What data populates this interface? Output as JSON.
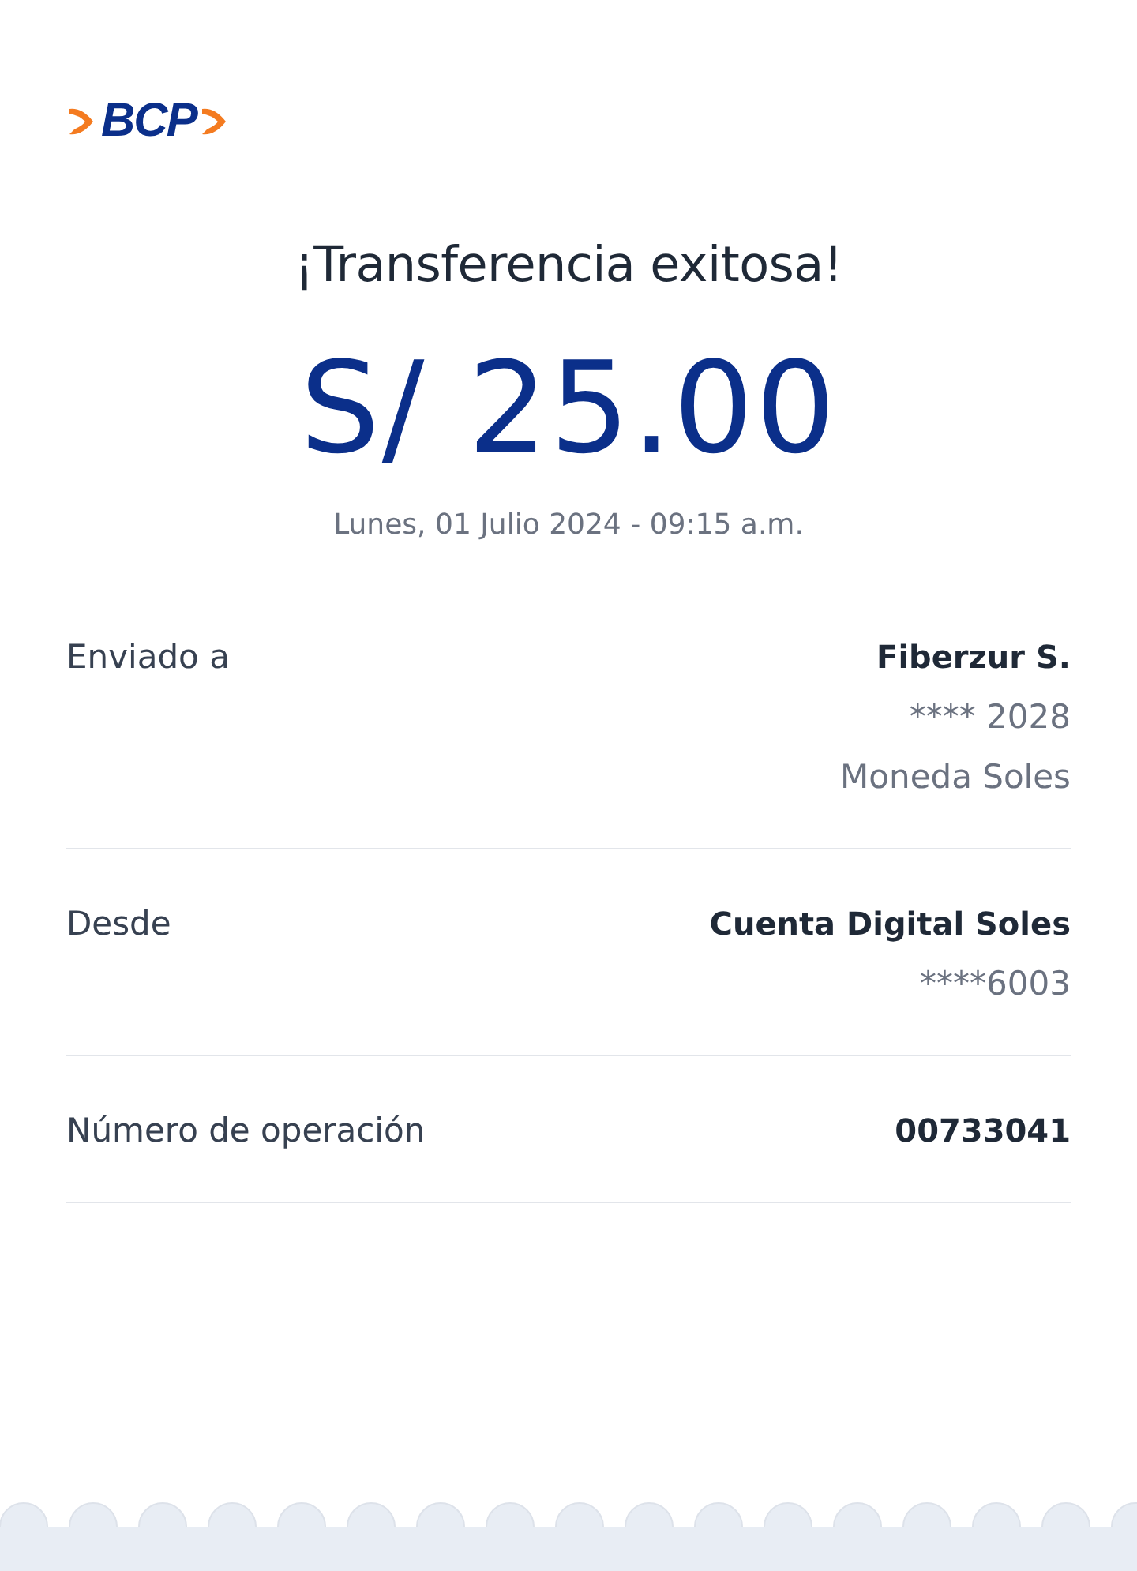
{
  "logo": {
    "text": "BCP"
  },
  "title": "¡Transferencia exitosa!",
  "amount": "S/ 25.00",
  "datetime": "Lunes, 01 Julio 2024 - 09:15 a.m.",
  "details": [
    {
      "label": "Enviado a",
      "values": [
        {
          "text": "Fiberzur S.",
          "kind": "strong"
        },
        {
          "text": "**** 2028",
          "kind": "muted"
        },
        {
          "text": "Moneda Soles",
          "kind": "muted"
        }
      ]
    },
    {
      "label": "Desde",
      "values": [
        {
          "text": "Cuenta Digital Soles",
          "kind": "strong"
        },
        {
          "text": "****6003",
          "kind": "muted"
        }
      ]
    },
    {
      "label": "Número de operación",
      "values": [
        {
          "text": "00733041",
          "kind": "strong"
        }
      ]
    }
  ]
}
